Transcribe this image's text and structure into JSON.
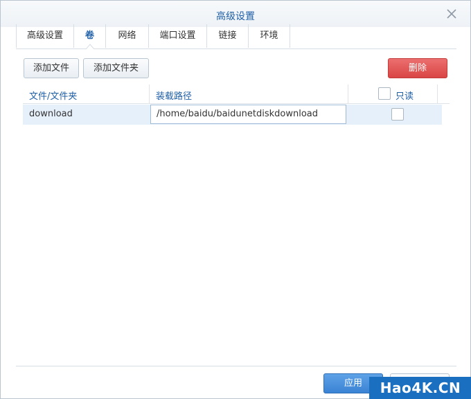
{
  "dialog": {
    "title": "高级设置",
    "close_icon": "close-icon"
  },
  "tabs": [
    {
      "label": "高级设置",
      "active": false
    },
    {
      "label": "卷",
      "active": true
    },
    {
      "label": "网络",
      "active": false
    },
    {
      "label": "端口设置",
      "active": false
    },
    {
      "label": "链接",
      "active": false
    },
    {
      "label": "环境",
      "active": false
    }
  ],
  "toolbar": {
    "add_file_label": "添加文件",
    "add_folder_label": "添加文件夹",
    "delete_label": "删除"
  },
  "table": {
    "columns": [
      "文件/文件夹",
      "装载路径",
      "只读"
    ],
    "rows": [
      {
        "file_folder": "download",
        "mount_path": "/home/baidu/baidunetdiskdownload",
        "read_only": false
      }
    ]
  },
  "footer": {
    "apply_label": "应用",
    "cancel_label": ""
  },
  "watermark": "Hao4K.CN",
  "colors": {
    "accent": "#1f5fa6",
    "danger": "#d94545",
    "primary": "#3a82d4",
    "row_selected": "#e6f0fb"
  }
}
